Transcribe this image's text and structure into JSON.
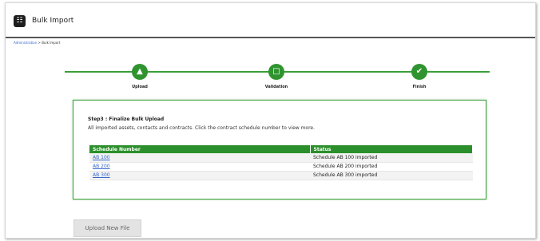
{
  "header": {
    "title": "Bulk Import",
    "logo_icon": "bulk-import-logo-icon"
  },
  "breadcrumb": {
    "root": "Administration",
    "separator": " > ",
    "current": "Bulk Import"
  },
  "steps": [
    {
      "label": "Upload",
      "icon": "upload-user-icon"
    },
    {
      "label": "Validation",
      "icon": "document-icon"
    },
    {
      "label": "Finish",
      "icon": "checkmark-icon"
    }
  ],
  "panel": {
    "title": "Step3 : Finalize Bulk Upload",
    "description": "All imported assets, contacts and contracts. Click the contract schedule number to view more."
  },
  "table": {
    "headers": [
      "Schedule Number",
      "Status"
    ],
    "rows": [
      {
        "schedule": "AB 100",
        "status": "Schedule AB 100 imported"
      },
      {
        "schedule": "AB 200",
        "status": "Schedule AB 200 imported"
      },
      {
        "schedule": "AB 300",
        "status": "Schedule AB 300 imported"
      }
    ]
  },
  "actions": {
    "upload_new_file": "Upload New File"
  },
  "colors": {
    "accent": "#2f942f",
    "link": "#3366cc"
  }
}
